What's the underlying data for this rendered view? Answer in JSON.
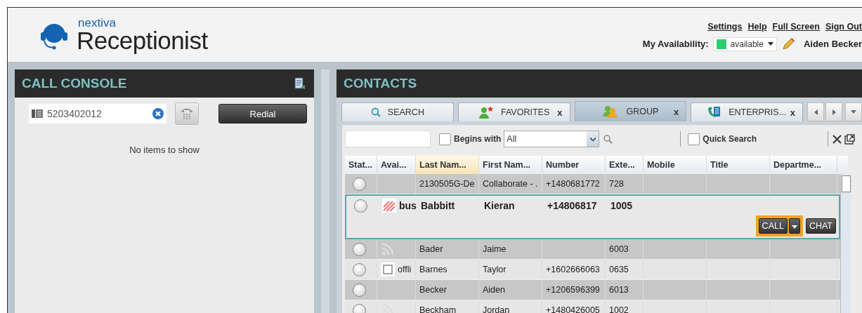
{
  "header": {
    "brand": "nextiva",
    "product": "Receptionist",
    "links": [
      "Settings",
      "Help",
      "Full Screen",
      "Sign Out"
    ],
    "availability": {
      "label": "My Availability:",
      "value": "available"
    },
    "user_name": "Aiden Becker"
  },
  "call_console": {
    "title": "CALL CONSOLE",
    "dial_value": "5203402012",
    "redial": "Redial",
    "empty_text": "No items to show"
  },
  "contacts": {
    "title": "CONTACTS",
    "tabs": [
      {
        "kind": "search",
        "label": "SEARCH",
        "selected": false
      },
      {
        "kind": "favorites",
        "label": "FAVORITES",
        "close": "x",
        "selected": false
      },
      {
        "kind": "group",
        "label": "GROUP",
        "close": "x",
        "selected": true
      },
      {
        "kind": "enterprise",
        "label": "ENTERPRIS...",
        "close": "x",
        "selected": false
      }
    ],
    "toolbar": {
      "begins_with": {
        "label": "Begins with",
        "checked": false
      },
      "filter": "All",
      "quick_search": {
        "label": "Quick Search",
        "checked": false
      }
    },
    "table": {
      "columns": [
        {
          "label": "Stat...",
          "sorted": false
        },
        {
          "label": "Avai...",
          "sorted": false
        },
        {
          "label": "Last Nam...",
          "sorted": true
        },
        {
          "label": "First Nam...",
          "sorted": false
        },
        {
          "label": "Number",
          "sorted": false
        },
        {
          "label": "Exte...",
          "sorted": false
        },
        {
          "label": "Mobile",
          "sorted": false
        },
        {
          "label": "Title",
          "sorted": false
        },
        {
          "label": "Departme...",
          "sorted": false
        }
      ],
      "rows": [
        {
          "checked": false,
          "kind": "none",
          "last": "2130505G-De",
          "first": "Collaborate - .",
          "number": "+1480681772",
          "ext": "728",
          "selected": false
        },
        {
          "checked": false,
          "kind": "busy",
          "availability_text": "bus",
          "last": "Babbitt",
          "first": "Kieran",
          "number": "+14806817",
          "ext": "1005",
          "selected": true,
          "actions": {
            "call": "CALL",
            "chat": "CHAT"
          }
        },
        {
          "checked": false,
          "kind": "feed",
          "last": "Bader",
          "first": "Jaime",
          "ext": "6003",
          "selected": false
        },
        {
          "checked": false,
          "kind": "offline",
          "availability_text": "offli",
          "last": "Barnes",
          "first": "Taylor",
          "number": "+1602666063",
          "ext": "0635",
          "selected": false
        },
        {
          "checked": false,
          "kind": "none",
          "last": "Becker",
          "first": "Aiden",
          "number": "+1206596399",
          "ext": "6013",
          "selected": false
        },
        {
          "checked": false,
          "kind": "feed",
          "last": "Beckham",
          "first": "Jordan",
          "number": "+1480426005",
          "ext": "1002",
          "selected": false
        }
      ]
    }
  }
}
